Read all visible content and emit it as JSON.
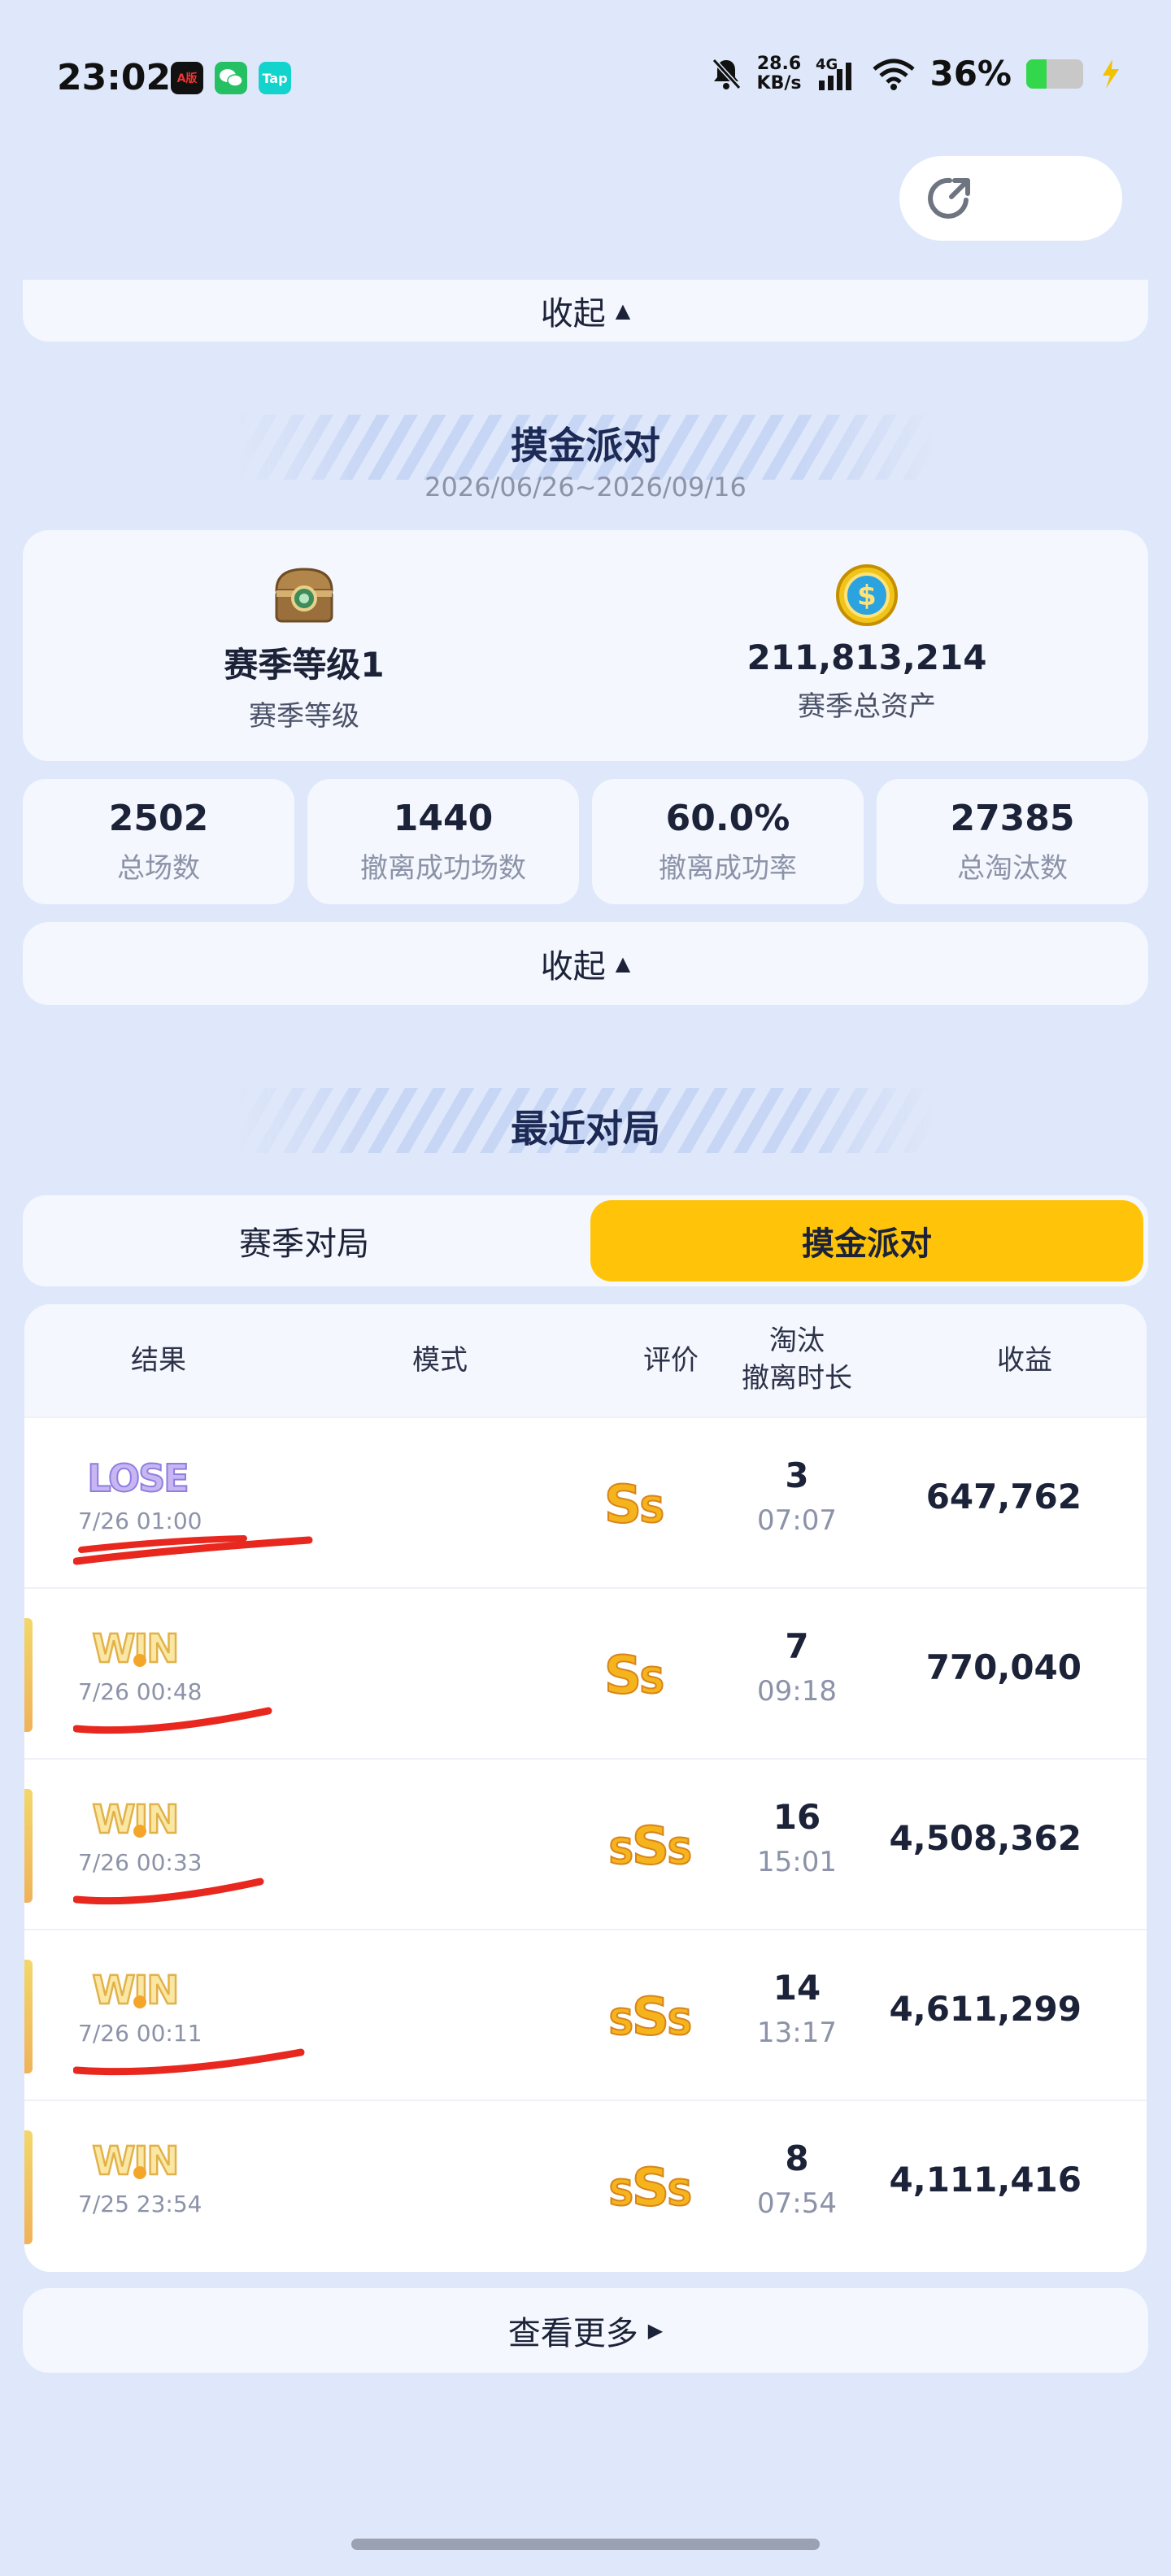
{
  "status_bar": {
    "time": "23:02",
    "apps": [
      {
        "name": "ai-app-icon",
        "label": "A版",
        "color": "#111111"
      },
      {
        "name": "wechat-icon",
        "label": "",
        "color": "#24c063"
      },
      {
        "name": "taptap-icon",
        "label": "Tap",
        "color": "#13d3cd"
      }
    ],
    "net_speed_value": "28.6",
    "net_speed_unit": "KB/s",
    "network": "4G",
    "battery_percent": "36%",
    "battery_level": 0.36
  },
  "top_collapse": {
    "label": "收起"
  },
  "season": {
    "title": "摸金派对",
    "date_range": "2026/06/26~2026/09/16",
    "level_value": "赛季等级1",
    "level_label": "赛季等级",
    "assets_value": "211,813,214",
    "assets_label": "赛季总资产"
  },
  "stats": [
    {
      "value": "2502",
      "label": "总场数"
    },
    {
      "value": "1440",
      "label": "撤离成功场数"
    },
    {
      "value": "60.0%",
      "label": "撤离成功率"
    },
    {
      "value": "27385",
      "label": "总淘汰数"
    }
  ],
  "stats_collapse": {
    "label": "收起"
  },
  "recent": {
    "title": "最近对局",
    "tabs": [
      {
        "label": "赛季对局",
        "active": false
      },
      {
        "label": "摸金派对",
        "active": true
      }
    ],
    "columns": {
      "result": "结果",
      "mode": "模式",
      "rating": "评价",
      "kills_line1": "淘汰",
      "kills_line2": "撤离时长",
      "income": "收益"
    },
    "rows": [
      {
        "result": "LOSE",
        "time": "7/26 01:00",
        "grade": "SS",
        "kills": "3",
        "duration": "07:07",
        "income": "647,762"
      },
      {
        "result": "WIN",
        "time": "7/26 00:48",
        "grade": "SS",
        "kills": "7",
        "duration": "09:18",
        "income": "770,040"
      },
      {
        "result": "WIN",
        "time": "7/26 00:33",
        "grade": "SSS",
        "kills": "16",
        "duration": "15:01",
        "income": "4,508,362"
      },
      {
        "result": "WIN",
        "time": "7/26 00:11",
        "grade": "SSS",
        "kills": "14",
        "duration": "13:17",
        "income": "4,611,299"
      },
      {
        "result": "WIN",
        "time": "7/25 23:54",
        "grade": "SSS",
        "kills": "8",
        "duration": "07:54",
        "income": "4,111,416"
      }
    ],
    "more_label": "查看更多"
  },
  "colors": {
    "background": "#dfe8fa",
    "accent": "#ffc40a",
    "card": "#f4f7fe",
    "redaction": "#e8281e"
  }
}
